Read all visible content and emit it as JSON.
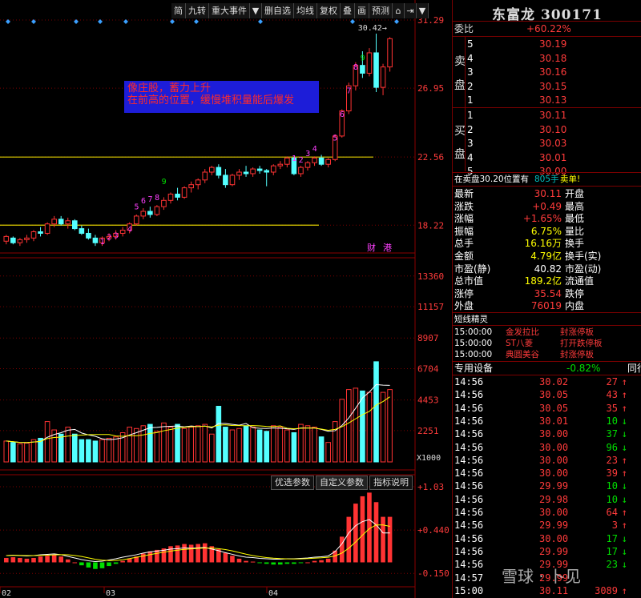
{
  "toolbar": {
    "items": [
      "简",
      "九转",
      "重大事件",
      "",
      "删自选",
      "均线",
      "复权",
      "叠",
      "画",
      "预测",
      "",
      "",
      ""
    ]
  },
  "annotation": {
    "line1": "像庄股，蓄力上升",
    "line2": "在前高的位置，缓慢堆积量能后爆发"
  },
  "price_axis": [
    "31.29",
    "26.95",
    "22.56",
    "18.22"
  ],
  "volume_axis": [
    "13360",
    "11157",
    "8907",
    "6704",
    "4453",
    "2251",
    "X1000"
  ],
  "macd_axis": [
    "+1.03",
    "+0.440",
    "-0.150"
  ],
  "date_labels": [
    "02",
    "03",
    "04"
  ],
  "high_label": "30.42",
  "finance_tags": [
    "财",
    "港"
  ],
  "td_labels_up": [
    "1",
    "2",
    "3",
    "4",
    "5",
    "6",
    "7",
    "8",
    "9"
  ],
  "sub_buttons": [
    "优选参数",
    "自定义参数",
    "指标说明"
  ],
  "chart_data": {
    "type": "candlestick",
    "ylim": [
      16.5,
      31.8
    ],
    "support_lines": [
      22.56,
      18.22
    ],
    "candles": [
      [
        17.2,
        17.6,
        17.0,
        17.5
      ],
      [
        17.4,
        17.5,
        17.0,
        17.1
      ],
      [
        17.1,
        17.4,
        16.9,
        17.3
      ],
      [
        17.3,
        17.6,
        17.1,
        17.4
      ],
      [
        17.4,
        17.9,
        17.2,
        17.8
      ],
      [
        17.8,
        18.1,
        17.5,
        17.7
      ],
      [
        17.7,
        18.4,
        17.6,
        18.3
      ],
      [
        18.3,
        18.8,
        18.1,
        18.6
      ],
      [
        18.6,
        18.8,
        18.2,
        18.3
      ],
      [
        18.3,
        18.7,
        18.0,
        18.5
      ],
      [
        18.5,
        18.6,
        17.9,
        18.0
      ],
      [
        18.0,
        18.2,
        17.6,
        17.7
      ],
      [
        17.7,
        18.0,
        17.3,
        17.4
      ],
      [
        17.4,
        17.6,
        16.9,
        17.1
      ],
      [
        17.1,
        17.5,
        16.9,
        17.4
      ],
      [
        17.4,
        17.7,
        17.2,
        17.5
      ],
      [
        17.5,
        17.9,
        17.3,
        17.7
      ],
      [
        17.7,
        18.1,
        17.5,
        17.9
      ],
      [
        17.9,
        18.4,
        17.7,
        18.3
      ],
      [
        18.3,
        18.9,
        18.2,
        18.8
      ],
      [
        18.8,
        19.3,
        18.6,
        19.1
      ],
      [
        19.1,
        19.4,
        18.7,
        18.9
      ],
      [
        18.9,
        19.5,
        18.8,
        19.4
      ],
      [
        19.4,
        20.0,
        19.2,
        19.8
      ],
      [
        19.8,
        20.3,
        19.6,
        20.2
      ],
      [
        20.2,
        20.6,
        19.8,
        20.0
      ],
      [
        20.0,
        20.7,
        19.9,
        20.6
      ],
      [
        20.6,
        21.0,
        20.3,
        20.8
      ],
      [
        20.8,
        21.2,
        20.5,
        21.1
      ],
      [
        21.1,
        21.8,
        20.9,
        21.6
      ],
      [
        21.6,
        22.0,
        21.4,
        21.9
      ],
      [
        21.9,
        22.1,
        21.2,
        21.4
      ],
      [
        21.4,
        21.8,
        20.6,
        20.8
      ],
      [
        20.8,
        21.5,
        20.7,
        21.4
      ],
      [
        21.4,
        21.8,
        21.1,
        21.6
      ],
      [
        21.6,
        22.0,
        21.3,
        21.5
      ],
      [
        21.5,
        21.9,
        21.3,
        21.8
      ],
      [
        21.8,
        22.0,
        21.5,
        21.7
      ],
      [
        21.7,
        21.8,
        20.7,
        21.6
      ],
      [
        21.6,
        22.1,
        21.4,
        22.0
      ],
      [
        22.0,
        22.3,
        21.8,
        22.1
      ],
      [
        22.1,
        22.6,
        21.9,
        22.5
      ],
      [
        22.5,
        22.6,
        21.4,
        21.5
      ],
      [
        21.5,
        22.0,
        21.3,
        21.9
      ],
      [
        21.9,
        22.3,
        21.7,
        22.2
      ],
      [
        22.2,
        22.6,
        22.0,
        22.5
      ],
      [
        22.5,
        22.7,
        22.0,
        22.1
      ],
      [
        22.1,
        22.5,
        21.9,
        22.4
      ],
      [
        22.4,
        24.0,
        22.3,
        23.9
      ],
      [
        23.9,
        25.6,
        23.8,
        25.5
      ],
      [
        25.5,
        27.3,
        25.3,
        27.1
      ],
      [
        27.1,
        28.6,
        26.8,
        28.4
      ],
      [
        28.4,
        29.3,
        27.6,
        27.9
      ],
      [
        27.9,
        29.5,
        27.7,
        29.2
      ],
      [
        29.2,
        30.42,
        26.7,
        27.0
      ],
      [
        27.0,
        28.5,
        26.5,
        28.3
      ],
      [
        28.3,
        30.2,
        28.0,
        30.1
      ]
    ],
    "volumes": [
      1500,
      1400,
      1300,
      1350,
      1600,
      1700,
      2900,
      2300,
      2000,
      2500,
      2000,
      1600,
      1600,
      1500,
      1600,
      1700,
      1800,
      2100,
      2500,
      2400,
      2600,
      2700,
      2200,
      2800,
      2500,
      2700,
      2400,
      2500,
      2600,
      2700,
      2000,
      4000,
      2500,
      2300,
      2400,
      2600,
      2500,
      2300,
      2200,
      2600,
      2500,
      2300,
      2100,
      2700,
      2600,
      2500,
      1800,
      1400,
      2900,
      4500,
      5200,
      5300,
      5100,
      5000,
      7200,
      5000,
      5200
    ],
    "volume_ylim": [
      0,
      14500
    ],
    "macd_ylim": [
      -0.3,
      1.15
    ],
    "macd_hist": [
      0.06,
      0.07,
      0.06,
      0.05,
      0.06,
      0.08,
      0.09,
      0.1,
      0.08,
      0.04,
      0.0,
      -0.04,
      -0.07,
      -0.09,
      -0.08,
      -0.05,
      -0.02,
      0.02,
      0.05,
      0.08,
      0.12,
      0.15,
      0.17,
      0.19,
      0.22,
      0.23,
      0.25,
      0.24,
      0.25,
      0.26,
      0.22,
      0.18,
      0.13,
      0.09,
      0.05,
      0.02,
      0.01,
      -0.01,
      -0.02,
      -0.03,
      -0.03,
      -0.02,
      -0.02,
      -0.01,
      0.0,
      0.02,
      0.03,
      0.05,
      0.16,
      0.35,
      0.62,
      0.8,
      0.9,
      0.95,
      0.82,
      0.62,
      0.62
    ],
    "vol_ma1_color": "#ffffff",
    "vol_ma2_color": "#ffff00",
    "up_color": "#ff3333",
    "down_color": "#54ffff"
  },
  "stock": {
    "title": "东富龙 300171",
    "weibi_label": "委比",
    "weibi_value": "+60.22%",
    "sell_side_label": [
      "卖",
      "盘"
    ],
    "buy_side_label": [
      "买",
      "盘"
    ],
    "sells": [
      {
        "lvl": "5",
        "price": "30.19"
      },
      {
        "lvl": "4",
        "price": "30.18"
      },
      {
        "lvl": "3",
        "price": "30.16"
      },
      {
        "lvl": "2",
        "price": "30.15"
      },
      {
        "lvl": "1",
        "price": "30.13"
      }
    ],
    "buys": [
      {
        "lvl": "1",
        "price": "30.11"
      },
      {
        "lvl": "2",
        "price": "30.10"
      },
      {
        "lvl": "3",
        "price": "30.03"
      },
      {
        "lvl": "4",
        "price": "30.01"
      },
      {
        "lvl": "5",
        "price": "30.00"
      }
    ],
    "ticker_note": "在卖盘30.20位置有",
    "ticker_qty": "805手",
    "ticker_tag": "卖单!",
    "quotes": [
      {
        "l": "最新",
        "v": "30.11",
        "r": "开盘",
        "c": "red"
      },
      {
        "l": "涨跌",
        "v": "+0.49",
        "r": "最高",
        "c": "red"
      },
      {
        "l": "涨幅",
        "v": "+1.65%",
        "r": "最低",
        "c": "red"
      },
      {
        "l": "振幅",
        "v": "6.75%",
        "r": "量比",
        "c": "yellow"
      },
      {
        "l": "总手",
        "v": "16.16万",
        "r": "换手",
        "c": "yellow"
      },
      {
        "l": "金额",
        "v": "4.79亿",
        "r": "换手(实)",
        "c": "yellow"
      },
      {
        "l": "市盈(静)",
        "v": "40.82",
        "r": "市盈(动)",
        "c": "white"
      },
      {
        "l": "总市值",
        "v": "189.2亿",
        "r": "流通值",
        "c": "yellow"
      },
      {
        "l": "涨停",
        "v": "35.54",
        "r": "跌停",
        "c": "red"
      },
      {
        "l": "外盘",
        "v": "76019",
        "r": "内盘",
        "c": "red"
      }
    ],
    "short_title": "短线精灵",
    "shorts": [
      {
        "t": "15:00:00",
        "n": "金发拉比",
        "e": "封涨停板"
      },
      {
        "t": "15:00:00",
        "n": "ST八菱",
        "e": "打开跌停板"
      },
      {
        "t": "15:00:00",
        "n": "典圆美谷",
        "e": "封涨停板"
      }
    ],
    "sector_name": "专用设备",
    "sector_change": "-0.82%",
    "sector_more": "同行",
    "ticks": [
      {
        "t": "14:56",
        "p": "30.02",
        "q": "27",
        "d": "up"
      },
      {
        "t": "14:56",
        "p": "30.05",
        "q": "43",
        "d": "up"
      },
      {
        "t": "14:56",
        "p": "30.05",
        "q": "35",
        "d": "up"
      },
      {
        "t": "14:56",
        "p": "30.01",
        "q": "10",
        "d": "down"
      },
      {
        "t": "14:56",
        "p": "30.00",
        "q": "37",
        "d": "down"
      },
      {
        "t": "14:56",
        "p": "30.00",
        "q": "96",
        "d": "down"
      },
      {
        "t": "14:56",
        "p": "30.00",
        "q": "23",
        "d": "up"
      },
      {
        "t": "14:56",
        "p": "30.00",
        "q": "39",
        "d": "up"
      },
      {
        "t": "14:56",
        "p": "29.99",
        "q": "10",
        "d": "down"
      },
      {
        "t": "14:56",
        "p": "29.98",
        "q": "10",
        "d": "down"
      },
      {
        "t": "14:56",
        "p": "30.00",
        "q": "64",
        "d": "up"
      },
      {
        "t": "14:56",
        "p": "29.99",
        "q": "3",
        "d": "up"
      },
      {
        "t": "14:56",
        "p": "30.00",
        "q": "17",
        "d": "down"
      },
      {
        "t": "14:56",
        "p": "29.99",
        "q": "17",
        "d": "down"
      },
      {
        "t": "14:56",
        "p": "29.99",
        "q": "23",
        "d": "down"
      },
      {
        "t": "14:57",
        "p": "29.99",
        "q": "",
        "d": ""
      },
      {
        "t": "15:00",
        "p": "30.11",
        "q": "3089",
        "d": "up"
      }
    ]
  },
  "watermark": "雪球 · 卜见"
}
